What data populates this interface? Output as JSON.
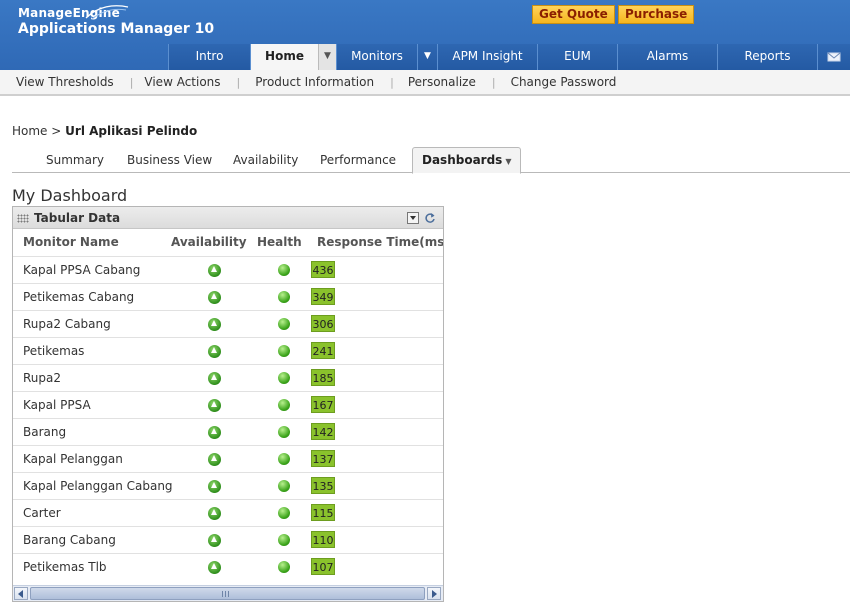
{
  "header": {
    "brand_top": "ManageEngine",
    "brand_product": "Applications Manager 10",
    "get_quote": "Get Quote",
    "purchase": "Purchase",
    "colors": {
      "header_blue": "#2f69b6",
      "button_yellow": "#f5b51e",
      "button_text": "#8a1f00"
    }
  },
  "nav": {
    "items": [
      {
        "label": "Intro"
      },
      {
        "label": "Home"
      },
      {
        "label": "Monitors"
      },
      {
        "label": "APM Insight"
      },
      {
        "label": "EUM"
      },
      {
        "label": "Alarms"
      },
      {
        "label": "Reports"
      }
    ],
    "active": "Home",
    "mail_icon": "mail-icon"
  },
  "subnav": {
    "items": [
      {
        "label": "View Thresholds"
      },
      {
        "label": "View Actions"
      },
      {
        "label": "Product Information"
      },
      {
        "label": "Personalize"
      },
      {
        "label": "Change Password"
      }
    ],
    "separator": "|"
  },
  "breadcrumb": {
    "home": "Home",
    "separator": ">",
    "current": "Url Aplikasi Pelindo"
  },
  "tabs": {
    "items": [
      {
        "label": "Summary"
      },
      {
        "label": "Business View"
      },
      {
        "label": "Availability"
      },
      {
        "label": "Performance"
      },
      {
        "label": "Dashboards"
      }
    ],
    "active": "Dashboards"
  },
  "dashboard": {
    "title": "My Dashboard",
    "widget": {
      "title": "Tabular Data",
      "icons": [
        "collapse-icon",
        "refresh-icon"
      ],
      "columns": [
        "Monitor Name",
        "Availability",
        "Health",
        "Response Time(ms)"
      ],
      "rows": [
        {
          "name": "Kapal PPSA Cabang",
          "availability": "up",
          "health": "clear",
          "response_time": "436"
        },
        {
          "name": "Petikemas Cabang",
          "availability": "up",
          "health": "clear",
          "response_time": "349"
        },
        {
          "name": "Rupa2 Cabang",
          "availability": "up",
          "health": "clear",
          "response_time": "306"
        },
        {
          "name": "Petikemas",
          "availability": "up",
          "health": "clear",
          "response_time": "241"
        },
        {
          "name": "Rupa2",
          "availability": "up",
          "health": "clear",
          "response_time": "185"
        },
        {
          "name": "Kapal PPSA",
          "availability": "up",
          "health": "clear",
          "response_time": "167"
        },
        {
          "name": "Barang",
          "availability": "up",
          "health": "clear",
          "response_time": "142"
        },
        {
          "name": "Kapal Pelanggan",
          "availability": "up",
          "health": "clear",
          "response_time": "137"
        },
        {
          "name": "Kapal Pelanggan Cabang",
          "availability": "up",
          "health": "clear",
          "response_time": "135"
        },
        {
          "name": "Carter",
          "availability": "up",
          "health": "clear",
          "response_time": "115"
        },
        {
          "name": "Barang Cabang",
          "availability": "up",
          "health": "clear",
          "response_time": "110"
        },
        {
          "name": "Petikemas Tlb",
          "availability": "up",
          "health": "clear",
          "response_time": "107"
        }
      ],
      "colors": {
        "response_badge": "#8ac22c",
        "status_green": "#3aa319"
      }
    }
  }
}
